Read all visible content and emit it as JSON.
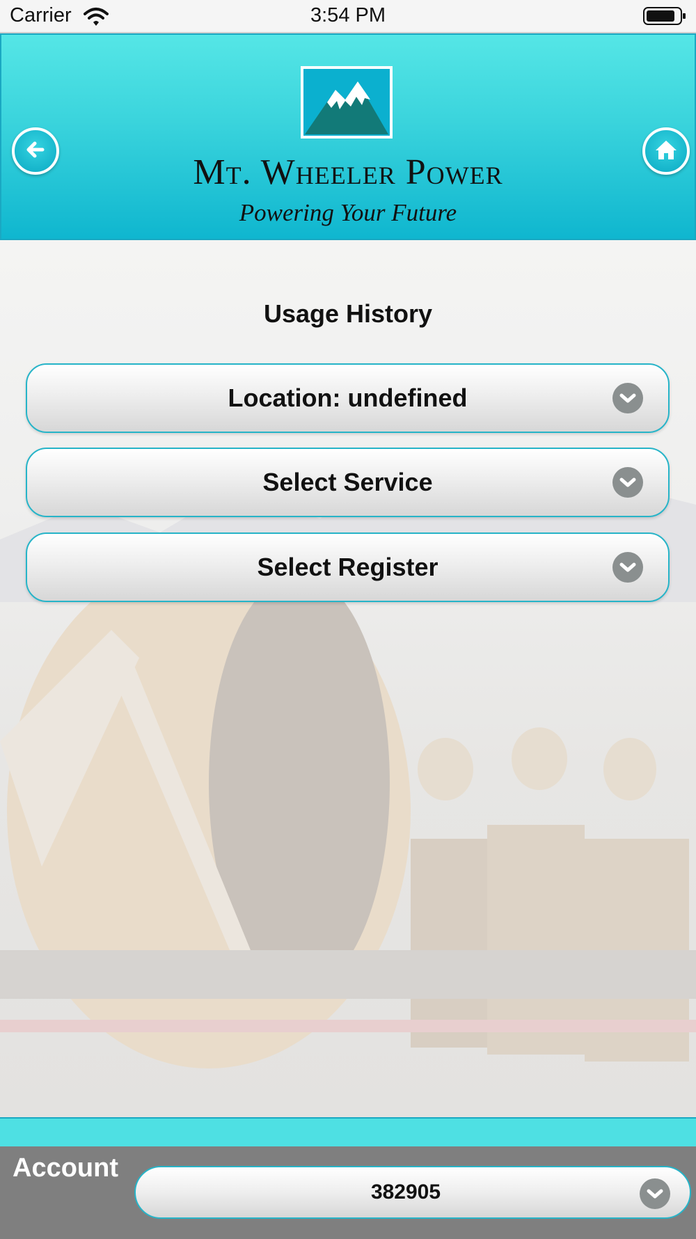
{
  "status_bar": {
    "carrier": "Carrier",
    "time": "3:54 PM",
    "icons": [
      "wifi-icon",
      "battery-icon"
    ]
  },
  "header": {
    "brand_name": "Mt. Wheeler Power",
    "tagline": "Powering Your Future",
    "back_icon": "arrow-left-icon",
    "home_icon": "home-icon",
    "colors": {
      "header_top": "#55e6e6",
      "header_bottom": "#0fb6cf",
      "accent": "#26b4c8"
    }
  },
  "main": {
    "title": "Usage History",
    "selects": [
      {
        "label": "Location: undefined",
        "icon": "chevron-down-icon"
      },
      {
        "label": "Select Service",
        "icon": "chevron-down-icon"
      },
      {
        "label": "Select Register",
        "icon": "chevron-down-icon"
      }
    ]
  },
  "footer": {
    "account_label": "Account",
    "account_value": "382905",
    "colors": {
      "band": "#4ee0e3",
      "body": "#7f7f7f"
    }
  }
}
